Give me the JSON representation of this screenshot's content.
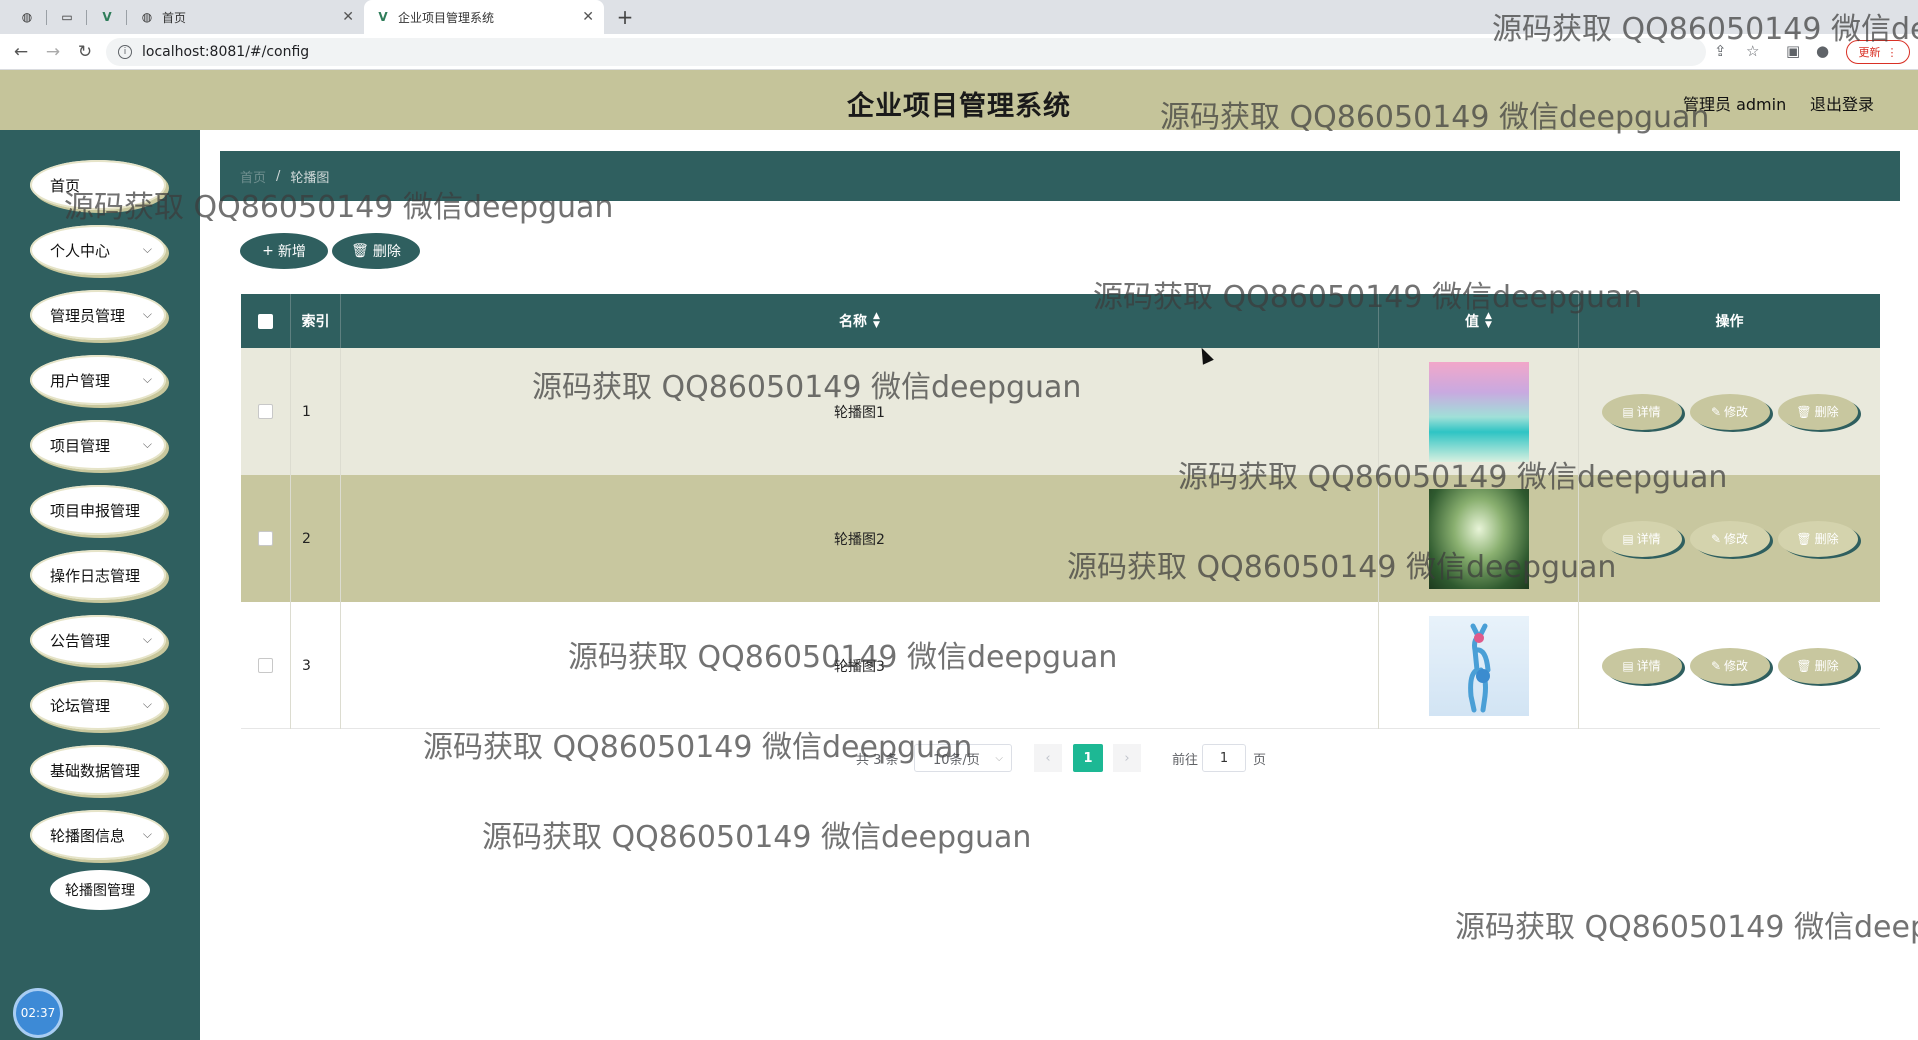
{
  "browser": {
    "tabs": [
      {
        "label": "首页"
      },
      {
        "label": "企业项目管理系统",
        "active": true
      }
    ],
    "new_tab": "+",
    "url": "localhost:8081/#/config",
    "update_label": "更新"
  },
  "header": {
    "title": "企业项目管理系统",
    "admin": "管理员 admin",
    "logout": "退出登录"
  },
  "sidebar": {
    "items": [
      {
        "label": "首页",
        "has_children": false
      },
      {
        "label": "个人中心",
        "has_children": true
      },
      {
        "label": "管理员管理",
        "has_children": true
      },
      {
        "label": "用户管理",
        "has_children": true
      },
      {
        "label": "项目管理",
        "has_children": true
      },
      {
        "label": "项目申报管理",
        "has_children": false
      },
      {
        "label": "操作日志管理",
        "has_children": false
      },
      {
        "label": "公告管理",
        "has_children": true
      },
      {
        "label": "论坛管理",
        "has_children": true
      },
      {
        "label": "基础数据管理",
        "has_children": false
      },
      {
        "label": "轮播图信息",
        "has_children": true,
        "expanded": true
      }
    ],
    "sub_item": "轮播图管理",
    "clock": "02:37"
  },
  "breadcrumb": {
    "home": "首页",
    "sep": "/",
    "current": "轮播图"
  },
  "toolbar": {
    "add": "新增",
    "delete": "删除"
  },
  "table": {
    "columns": {
      "index": "索引",
      "name": "名称",
      "value": "值",
      "actions": "操作"
    },
    "rows": [
      {
        "index": "1",
        "name": "轮播图1",
        "thumb": "pastel-sea-sky"
      },
      {
        "index": "2",
        "name": "轮播图2",
        "thumb": "sunlit-forest"
      },
      {
        "index": "3",
        "name": "轮播图3",
        "thumb": "blue-deer"
      }
    ],
    "actions": {
      "detail": "详情",
      "edit": "修改",
      "delete": "删除"
    }
  },
  "pagination": {
    "total": "共 3 条",
    "page_size": "10条/页",
    "current_page": "1",
    "goto_label": "前往",
    "goto_value": "1",
    "page_suffix": "页"
  },
  "watermark": {
    "text": "源码获取 QQ86050149 微信deepguan"
  },
  "colors": {
    "primary": "#2f5f5f",
    "header": "#c5c49a",
    "accent_pill": "#c8c79f",
    "pagination_active": "#1db894"
  }
}
